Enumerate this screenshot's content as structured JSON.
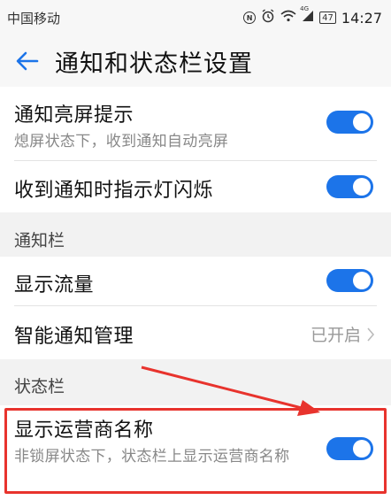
{
  "status_bar": {
    "carrier": "中国移动",
    "time": "14:27",
    "battery": "47",
    "network": "4G",
    "icons": [
      "nfc-icon",
      "alarm-icon",
      "wifi-icon",
      "signal-icon",
      "battery-icon"
    ]
  },
  "header": {
    "title": "通知和状态栏设置",
    "back_icon": "arrow-left-icon"
  },
  "items": {
    "screen_on_notify": {
      "title": "通知亮屏提示",
      "subtitle": "熄屏状态下，收到通知自动亮屏",
      "enabled": true
    },
    "indicator_light": {
      "title": "收到通知时指示灯闪烁",
      "enabled": true
    },
    "show_traffic": {
      "title": "显示流量",
      "enabled": true
    },
    "smart_notify": {
      "title": "智能通知管理",
      "value": "已开启"
    },
    "carrier_name": {
      "title": "显示运营商名称",
      "subtitle": "非锁屏状态下，状态栏上显示运营商名称",
      "enabled": true
    }
  },
  "sections": {
    "notification_bar": "通知栏",
    "status_bar": "状态栏"
  },
  "colors": {
    "toggle_on": "#1c74e9",
    "annotation": "#e8332d",
    "accent": "#1c74e9"
  }
}
